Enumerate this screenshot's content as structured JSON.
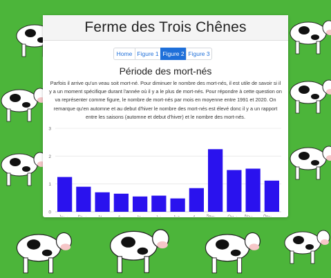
{
  "site": {
    "title": "Ferme des Trois Chênes"
  },
  "nav": {
    "tabs": [
      {
        "label": "Home",
        "active": false
      },
      {
        "label": "Figure 1",
        "active": false
      },
      {
        "label": "Figure 2",
        "active": true
      },
      {
        "label": "Figure 3",
        "active": false
      }
    ]
  },
  "section": {
    "title": "Période des mort-nés",
    "description": "Parfois il arrive qu'un veau soit mort-né. Pour diminuer le nombre des mort-nés, il est utile de savoir si il y a un moment spécifique durant l'année où il y a le plus de mort-nés. Pour répondre à cette question on va représenter comme figure, le nombre de mort-nés par mois en moyenne entre 1991 et 2020. On remarque qu'en automne et au debut d'hiver le nombre des mort-nés est élevé donc il y a un rapport entre les saisons (automne et debut d'hiver) et le nombre des mort-nés."
  },
  "colors": {
    "background": "#4cb53a",
    "accent": "#1e6fd9",
    "bar": "#2a12ee"
  },
  "chart_data": {
    "type": "bar",
    "categories": [
      "Janvier",
      "Fevrier",
      "Mars",
      "Avril",
      "Mai",
      "Juin",
      "Juillet",
      "Aout",
      "Septembre",
      "Octobre",
      "Novembre",
      "Decembre"
    ],
    "values": [
      1.25,
      0.9,
      0.7,
      0.65,
      0.55,
      0.58,
      0.48,
      0.85,
      2.25,
      1.5,
      1.55,
      1.12
    ],
    "ylim": [
      0,
      3
    ],
    "yticks": [
      "0",
      "1",
      "2",
      "3"
    ],
    "grid": true
  }
}
